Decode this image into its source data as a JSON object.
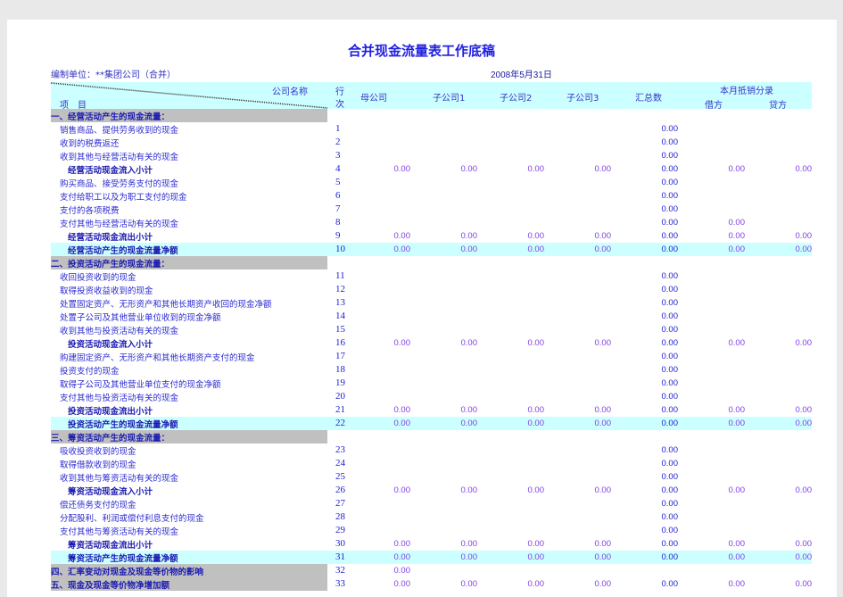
{
  "title": "合并现金流量表工作底稿",
  "unit": "编制单位：**集团公司（合并）",
  "date": "2008年5月31日",
  "header": {
    "company_name": "公司名称",
    "item": "项　目",
    "line_a": "行",
    "line_b": "次",
    "columns": [
      "母公司",
      "子公司1",
      "子公司2",
      "子公司3",
      "汇总数"
    ],
    "elimination": "本月抵销分录",
    "debit": "借方",
    "credit": "贷方"
  },
  "colors": {
    "header_bg": "#ccffff",
    "section_bg": "#c0c0c0",
    "text": "#2a2ad0"
  },
  "rows": [
    {
      "type": "section",
      "label": "一、经营活动产生的现金流量：",
      "no": "",
      "vals": []
    },
    {
      "type": "item",
      "label": "销售商品、提供劳务收到的现金",
      "no": "1",
      "vals": [
        null,
        null,
        null,
        null,
        "0.00",
        null,
        null
      ]
    },
    {
      "type": "item",
      "label": "收到的税费返还",
      "no": "2",
      "vals": [
        null,
        null,
        null,
        null,
        "0.00",
        null,
        null
      ]
    },
    {
      "type": "item",
      "label": "收到其他与经营活动有关的现金",
      "no": "3",
      "vals": [
        null,
        null,
        null,
        null,
        "0.00",
        null,
        null
      ]
    },
    {
      "type": "sub",
      "label": "经营活动现金流入小计",
      "no": "4",
      "vals": [
        "0.00",
        "0.00",
        "0.00",
        "0.00",
        "0.00",
        "0.00",
        "0.00"
      ]
    },
    {
      "type": "item",
      "label": "购买商品、接受劳务支付的现金",
      "no": "5",
      "vals": [
        null,
        null,
        null,
        null,
        "0.00",
        null,
        null
      ]
    },
    {
      "type": "item",
      "label": "支付给职工以及为职工支付的现金",
      "no": "6",
      "vals": [
        null,
        null,
        null,
        null,
        "0.00",
        null,
        null
      ]
    },
    {
      "type": "item",
      "label": "支付的各项税费",
      "no": "7",
      "vals": [
        null,
        null,
        null,
        null,
        "0.00",
        null,
        null
      ]
    },
    {
      "type": "item",
      "label": "支付其他与经营活动有关的现金",
      "no": "8",
      "vals": [
        null,
        null,
        null,
        null,
        "0.00",
        "0.00",
        null
      ]
    },
    {
      "type": "sub",
      "label": "经营活动现金流出小计",
      "no": "9",
      "vals": [
        "0.00",
        "0.00",
        "0.00",
        "0.00",
        "0.00",
        "0.00",
        "0.00"
      ]
    },
    {
      "type": "net",
      "label": "经营活动产生的现金流量净额",
      "no": "10",
      "vals": [
        "0.00",
        "0.00",
        "0.00",
        "0.00",
        "0.00",
        "0.00",
        "0.00"
      ]
    },
    {
      "type": "section",
      "label": "二、投资活动产生的现金流量：",
      "no": "",
      "vals": []
    },
    {
      "type": "item",
      "label": "收回投资收到的现金",
      "no": "11",
      "vals": [
        null,
        null,
        null,
        null,
        "0.00",
        null,
        null
      ]
    },
    {
      "type": "item",
      "label": "取得投资收益收到的现金",
      "no": "12",
      "vals": [
        null,
        null,
        null,
        null,
        "0.00",
        null,
        null
      ]
    },
    {
      "type": "item",
      "label": "处置固定资产、无形资产和其他长期资产收回的现金净额",
      "no": "13",
      "vals": [
        null,
        null,
        null,
        null,
        "0.00",
        null,
        null
      ]
    },
    {
      "type": "item",
      "label": "处置子公司及其他营业单位收到的现金净额",
      "no": "14",
      "vals": [
        null,
        null,
        null,
        null,
        "0.00",
        null,
        null
      ]
    },
    {
      "type": "item",
      "label": "收到其他与投资活动有关的现金",
      "no": "15",
      "vals": [
        null,
        null,
        null,
        null,
        "0.00",
        null,
        null
      ]
    },
    {
      "type": "sub",
      "label": "投资活动现金流入小计",
      "no": "16",
      "vals": [
        "0.00",
        "0.00",
        "0.00",
        "0.00",
        "0.00",
        "0.00",
        "0.00"
      ]
    },
    {
      "type": "item",
      "label": "购建固定资产、无形资产和其他长期资产支付的现金",
      "no": "17",
      "vals": [
        null,
        null,
        null,
        null,
        "0.00",
        null,
        null
      ]
    },
    {
      "type": "item",
      "label": "投资支付的现金",
      "no": "18",
      "vals": [
        null,
        null,
        null,
        null,
        "0.00",
        null,
        null
      ]
    },
    {
      "type": "item",
      "label": "取得子公司及其他营业单位支付的现金净额",
      "no": "19",
      "vals": [
        null,
        null,
        null,
        null,
        "0.00",
        null,
        null
      ]
    },
    {
      "type": "item",
      "label": "支付其他与投资活动有关的现金",
      "no": "20",
      "vals": [
        null,
        null,
        null,
        null,
        "0.00",
        null,
        null
      ]
    },
    {
      "type": "sub",
      "label": "投资活动现金流出小计",
      "no": "21",
      "vals": [
        "0.00",
        "0.00",
        "0.00",
        "0.00",
        "0.00",
        "0.00",
        "0.00"
      ]
    },
    {
      "type": "net",
      "label": "投资活动产生的现金流量净额",
      "no": "22",
      "vals": [
        "0.00",
        "0.00",
        "0.00",
        "0.00",
        "0.00",
        "0.00",
        "0.00"
      ]
    },
    {
      "type": "section",
      "label": "三、筹资活动产生的现金流量：",
      "no": "",
      "vals": []
    },
    {
      "type": "item",
      "label": "吸收投资收到的现金",
      "no": "23",
      "vals": [
        null,
        null,
        null,
        null,
        "0.00",
        null,
        null
      ]
    },
    {
      "type": "item",
      "label": "取得借款收到的现金",
      "no": "24",
      "vals": [
        null,
        null,
        null,
        null,
        "0.00",
        null,
        null
      ]
    },
    {
      "type": "item",
      "label": "收到其他与筹资活动有关的现金",
      "no": "25",
      "vals": [
        null,
        null,
        null,
        null,
        "0.00",
        null,
        null
      ]
    },
    {
      "type": "sub",
      "label": "筹资活动现金流入小计",
      "no": "26",
      "vals": [
        "0.00",
        "0.00",
        "0.00",
        "0.00",
        "0.00",
        "0.00",
        "0.00"
      ]
    },
    {
      "type": "item",
      "label": "偿还债务支付的现金",
      "no": "27",
      "vals": [
        null,
        null,
        null,
        null,
        "0.00",
        null,
        null
      ]
    },
    {
      "type": "item",
      "label": "分配股利、利润或偿付利息支付的现金",
      "no": "28",
      "vals": [
        null,
        null,
        null,
        null,
        "0.00",
        null,
        null
      ]
    },
    {
      "type": "item",
      "label": "支付其他与筹资活动有关的现金",
      "no": "29",
      "vals": [
        null,
        null,
        null,
        null,
        "0.00",
        null,
        null
      ]
    },
    {
      "type": "sub",
      "label": "筹资活动现金流出小计",
      "no": "30",
      "vals": [
        "0.00",
        "0.00",
        "0.00",
        "0.00",
        "0.00",
        "0.00",
        "0.00"
      ]
    },
    {
      "type": "net",
      "label": "筹资活动产生的现金流量净额",
      "no": "31",
      "vals": [
        "0.00",
        "0.00",
        "0.00",
        "0.00",
        "0.00",
        "0.00",
        "0.00"
      ]
    },
    {
      "type": "section",
      "label": "四、汇率变动对现金及现金等价物的影响",
      "no": "32",
      "vals": [
        "0.00",
        null,
        null,
        null,
        null,
        null,
        null
      ]
    },
    {
      "type": "section",
      "label": "五、现金及现金等价物净增加额",
      "no": "33",
      "vals": [
        "0.00",
        "0.00",
        "0.00",
        "0.00",
        "0.00",
        "0.00",
        "0.00"
      ]
    }
  ]
}
